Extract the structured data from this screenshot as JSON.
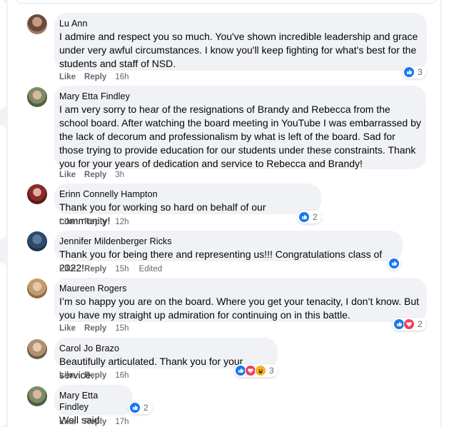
{
  "actions": {
    "like": "Like",
    "reply": "Reply",
    "edited": "Edited"
  },
  "comments": [
    {
      "author": "Lu Ann",
      "text": "I admire and respect you so much. You've shown incredible leadership and grace under very awful circumstances. I know you'll keep fighting for what's best for the students and staff of NSD.",
      "time": "16h",
      "reactions": "3"
    },
    {
      "author": "Mary Etta Findley",
      "text": "I am very sorry to hear of the resignations of Brandy and Rebecca from the school board. After watching the board meeting in YouTube I was embarrassed by the lack of decorum and professionalism by what is left of the board. Sad for those trying to provide education for our students under these constraints. Thank you for your years of dedication and service to Rebecca and Brandy!",
      "time": "3h"
    },
    {
      "author": "Erinn Connelly Hampton",
      "text": "Thank you for working so hard on behalf of our community!",
      "time": "12h",
      "reactions": "2"
    },
    {
      "author": "Jennifer Mildenberger Ricks",
      "text": "Thank you for being there and representing us!!! Congratulations class of 2022!",
      "time": "15h"
    },
    {
      "author": "Maureen Rogers",
      "text": "I’m so happy you are on the board. Where you get your tenacity, I don’t know. But you have my straight up admiration for continuing on in this battle.",
      "time": "15h",
      "reactions": "2"
    },
    {
      "author": "Carol Jo Brazo",
      "text": "Beautifully articulated. Thank you for your service.",
      "time": "16h",
      "reactions": "3"
    },
    {
      "author": "Mary Etta Findley",
      "text": "Well said",
      "time": "17h",
      "reactions": "2"
    }
  ],
  "reaction_icons": [
    "like-icon",
    "love-icon",
    "haha-icon"
  ],
  "colors": {
    "like": "#1877f2",
    "love": "#f33e58",
    "haha": "#f7b125",
    "bubble": "#f0f2f5",
    "meta": "#65676b"
  }
}
